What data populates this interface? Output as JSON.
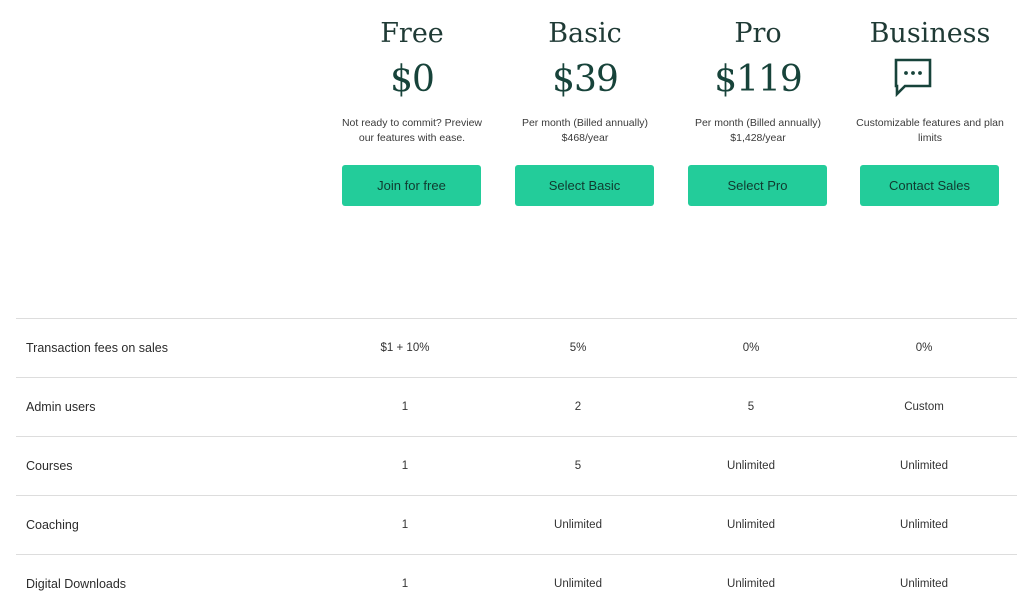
{
  "plans": [
    {
      "name": "Free",
      "price": "$0",
      "desc_line1": "Not ready to commit? Preview",
      "desc_line2": "our features with ease.",
      "button": "Join for free"
    },
    {
      "name": "Basic",
      "price": "$39",
      "desc_line1": "Per month (Billed annually)",
      "desc_line2": "$468/year",
      "button": "Select Basic"
    },
    {
      "name": "Pro",
      "price": "$119",
      "desc_line1": "Per month (Billed annually)",
      "desc_line2": "$1,428/year",
      "button": "Select Pro"
    },
    {
      "name": "Business",
      "icon": "chat-bubble-icon",
      "desc_line1": "Customizable features and plan",
      "desc_line2": "limits",
      "button": "Contact Sales"
    }
  ],
  "features": [
    {
      "label": "Transaction fees on sales",
      "values": [
        "$1 + 10%",
        "5%",
        "0%",
        "0%"
      ]
    },
    {
      "label": "Admin users",
      "values": [
        "1",
        "2",
        "5",
        "Custom"
      ]
    },
    {
      "label": "Courses",
      "values": [
        "1",
        "5",
        "Unlimited",
        "Unlimited"
      ]
    },
    {
      "label": "Coaching",
      "values": [
        "1",
        "Unlimited",
        "Unlimited",
        "Unlimited"
      ]
    },
    {
      "label": "Digital Downloads",
      "values": [
        "1",
        "Unlimited",
        "Unlimited",
        "Unlimited"
      ]
    }
  ],
  "colors": {
    "button_bg": "#23cc9a",
    "heading": "#1f3a35",
    "price": "#17433a",
    "divider": "#dddddd"
  }
}
